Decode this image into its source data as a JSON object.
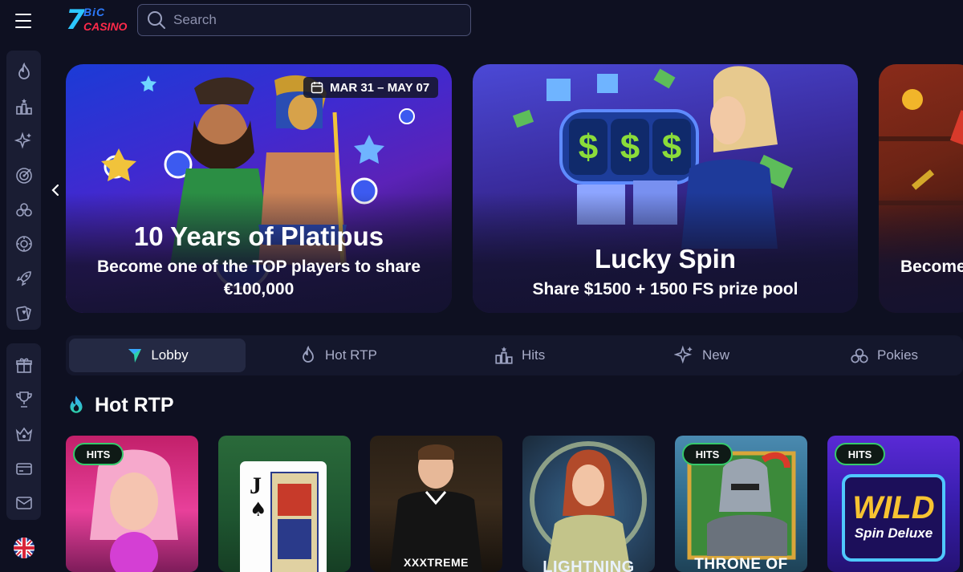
{
  "header": {
    "logo_top": "BiC",
    "logo_seven": "7",
    "logo_bottom": "CASINO",
    "search_placeholder": "Search"
  },
  "sidebar": {
    "group_a": [
      "flame-icon",
      "stars-icon",
      "sparkle-icon",
      "target-icon",
      "cherries-icon",
      "chip-icon",
      "rocket-icon",
      "card-heart-icon"
    ],
    "group_b": [
      "gift-icon",
      "trophy-icon",
      "crown-icon",
      "card-icon",
      "mail-icon"
    ]
  },
  "banners": [
    {
      "title": "10 Years of Platipus",
      "subtitle_line1": "Become one of the TOP players to share",
      "subtitle_line2": "€100,000",
      "date": "MAR 31 – MAY 07"
    },
    {
      "title": "Lucky Spin",
      "subtitle": "Share $1500 + 1500 FS prize pool"
    },
    {
      "subtitle": "Become"
    }
  ],
  "tabs": [
    {
      "label": "Lobby",
      "active": true
    },
    {
      "label": "Hot RTP",
      "active": false
    },
    {
      "label": "Hits",
      "active": false
    },
    {
      "label": "New",
      "active": false
    },
    {
      "label": "Pokies",
      "active": false
    }
  ],
  "section": {
    "title": "Hot RTP"
  },
  "games": [
    {
      "badge": "HITS",
      "caption": ""
    },
    {
      "badge": "",
      "caption": ""
    },
    {
      "badge": "",
      "caption": "XXXTREME"
    },
    {
      "badge": "",
      "caption": "LIGHTNING"
    },
    {
      "badge": "HITS",
      "caption": "THRONE OF"
    },
    {
      "badge": "HITS",
      "caption": "",
      "logo_main": "WILD",
      "logo_sub": "Spin Deluxe"
    }
  ],
  "colors": {
    "background": "#0e1021",
    "panel": "#1a1d33",
    "accent_green": "#36c96c",
    "active_tab": "#242943"
  }
}
